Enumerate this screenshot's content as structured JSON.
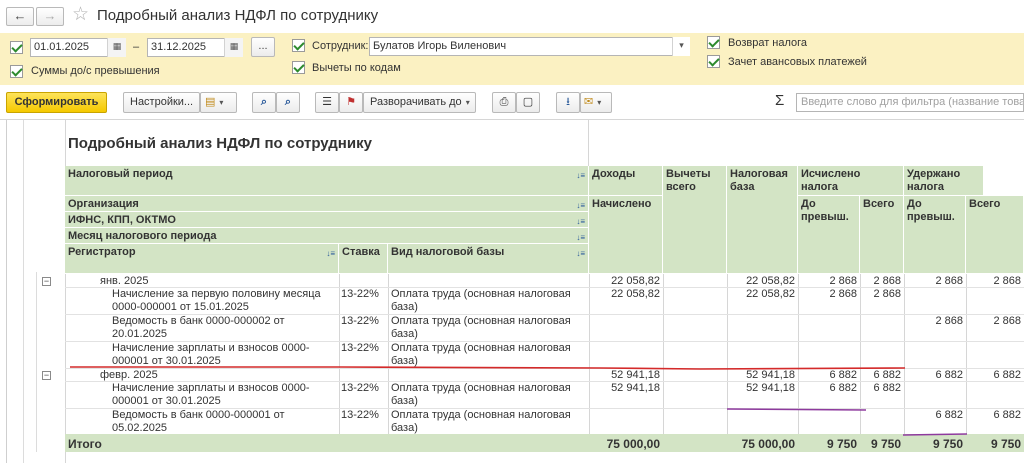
{
  "window": {
    "title": "Подробный анализ НДФЛ по сотруднику",
    "back": "←",
    "forward": "→"
  },
  "params": {
    "date_from": "01.01.2025",
    "date_dash": "–",
    "date_to": "31.12.2025",
    "dots": "...",
    "sums_label": "Суммы до/с превышения",
    "employee_label": "Сотрудник:",
    "employee_value": "Булатов Игорь Виленович",
    "deductions_label": "Вычеты по кодам",
    "refund_label": "Возврат налога",
    "advance_label": "Зачет авансовых платежей"
  },
  "toolbar": {
    "generate": "Сформировать",
    "settings": "Настройки...",
    "expand": "Разворачивать до",
    "sigma": "Σ",
    "search_placeholder": "Введите слово для фильтра (название товара"
  },
  "report": {
    "title": "Подробный анализ НДФЛ по сотруднику",
    "headers": {
      "tax_period": "Налоговый период",
      "organization": "Организация",
      "ifns": "ИФНС, КПП, ОКТМО",
      "month": "Месяц налогового периода",
      "registrar": "Регистратор",
      "rate": "Ставка",
      "base_kind": "Вид налоговой базы",
      "income": "Доходы",
      "accrued": "Начислено",
      "deductions": "Вычеты всего",
      "tax_base": "Налоговая база",
      "calculated": "Исчислено налога",
      "withheld": "Удержано налога",
      "before_excess": "До превыш.",
      "total": "Всего"
    },
    "rows": [
      {
        "label": "янв. 2025",
        "rate": "",
        "kind": "",
        "income": "22 058,82",
        "deduct": "",
        "base": "22 058,82",
        "calc_before": "2 868",
        "calc_total": "2 868",
        "with_before": "2 868",
        "with_total": "2 868"
      },
      {
        "label": "Начисление за первую половину месяца 0000-000001 от 15.01.2025",
        "rate": "13-22%",
        "kind": "Оплата труда (основная налоговая база)",
        "income": "22 058,82",
        "deduct": "",
        "base": "22 058,82",
        "calc_before": "2 868",
        "calc_total": "2 868",
        "with_before": "",
        "with_total": ""
      },
      {
        "label": "Ведомость в банк 0000-000002 от 20.01.2025",
        "rate": "13-22%",
        "kind": "Оплата труда (основная налоговая база)",
        "income": "",
        "deduct": "",
        "base": "",
        "calc_before": "",
        "calc_total": "",
        "with_before": "2 868",
        "with_total": "2 868"
      },
      {
        "label": "Начисление зарплаты и взносов 0000-000001 от 30.01.2025",
        "rate": "13-22%",
        "kind": "Оплата труда (основная налоговая база)",
        "income": "",
        "deduct": "",
        "base": "",
        "calc_before": "",
        "calc_total": "",
        "with_before": "",
        "with_total": ""
      },
      {
        "label": "февр. 2025",
        "rate": "",
        "kind": "",
        "income": "52 941,18",
        "deduct": "",
        "base": "52 941,18",
        "calc_before": "6 882",
        "calc_total": "6 882",
        "with_before": "6 882",
        "with_total": "6 882"
      },
      {
        "label": "Начисление зарплаты и взносов 0000-000001 от 30.01.2025",
        "rate": "13-22%",
        "kind": "Оплата труда (основная налоговая база)",
        "income": "52 941,18",
        "deduct": "",
        "base": "52 941,18",
        "calc_before": "6 882",
        "calc_total": "6 882",
        "with_before": "",
        "with_total": ""
      },
      {
        "label": "Ведомость в банк 0000-000001 от 05.02.2025",
        "rate": "13-22%",
        "kind": "Оплата труда (основная налоговая база)",
        "income": "",
        "deduct": "",
        "base": "",
        "calc_before": "",
        "calc_total": "",
        "with_before": "6 882",
        "with_total": "6 882"
      }
    ],
    "total": {
      "label": "Итого",
      "income": "75 000,00",
      "base": "75 000,00",
      "calc_before": "9 750",
      "calc_total": "9 750",
      "with_before": "9 750",
      "with_total": "9 750"
    },
    "colors": {
      "header_bg": "#d3e4c5",
      "accent": "#f5c900",
      "mark_red": "#d42a2a",
      "mark_purple": "#8e3a9e"
    }
  }
}
